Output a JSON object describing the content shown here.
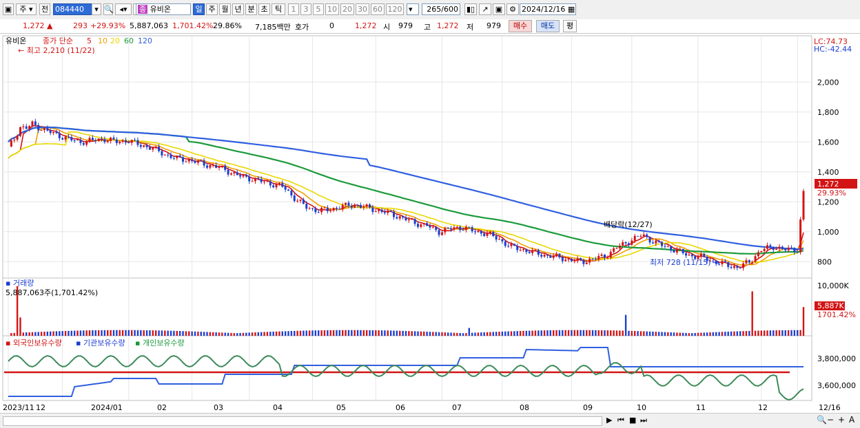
{
  "toolbar": {
    "market_type": "주",
    "prev_label": "전",
    "code": "084440",
    "stock_name": "유비온",
    "name_badge": "종",
    "periods": [
      "일",
      "주",
      "월",
      "년",
      "분",
      "초",
      "틱"
    ],
    "active_period": "일",
    "intervals": [
      "1",
      "3",
      "5",
      "10",
      "20",
      "30",
      "60",
      "120"
    ],
    "count": "265",
    "count_max": "/600",
    "date": "2024/12/16"
  },
  "quote": {
    "price": "1,272",
    "change": "293",
    "change_pct": "+29.93%",
    "volume": "5,887,063",
    "volume_ratio": "1,701.42%",
    "turnover": "29.86%",
    "amount": "7,185백만",
    "hoga_label": "호가",
    "hoga_value": "0",
    "hoga_price": "1,272",
    "open_label": "시",
    "open": "979",
    "high_label": "고",
    "high": "1,272",
    "low_label": "저",
    "low": "979",
    "buy_label": "매수",
    "sell_label": "매도",
    "eval_label": "평"
  },
  "chart_data": {
    "type": "candlestick",
    "title": "유비온",
    "ma_legend": {
      "label": "종가 단순",
      "periods": [
        "5",
        "10",
        "20",
        "60",
        "120"
      ],
      "colors": [
        "#d21414",
        "#f0a000",
        "#e8d800",
        "#1a9a3a",
        "#2f5fe0"
      ]
    },
    "price_axis": {
      "ticks": [
        800,
        1000,
        1200,
        1400,
        1600,
        1800,
        2000
      ],
      "ylim": [
        700,
        2300
      ]
    },
    "lc_label": "LC:74.73",
    "hc_label": "HC:-42.44",
    "current_price_label": "1,272",
    "current_pct_label": "29.93%",
    "annotations": {
      "high": "최고 2,210 (11/22)",
      "low": "최저 728 (11/15)",
      "dividend": "배당락(12/27)"
    },
    "price_path": [
      [
        0,
        1560
      ],
      [
        1,
        1620
      ],
      [
        2,
        1700
      ],
      [
        3,
        1690
      ],
      [
        4,
        1720
      ],
      [
        5,
        1700
      ],
      [
        6,
        1680
      ],
      [
        8,
        1650
      ],
      [
        10,
        1620
      ],
      [
        12,
        1600
      ],
      [
        14,
        1610
      ],
      [
        16,
        1620
      ],
      [
        18,
        1600
      ],
      [
        20,
        1610
      ],
      [
        22,
        1580
      ],
      [
        24,
        1560
      ],
      [
        26,
        1520
      ],
      [
        28,
        1490
      ],
      [
        30,
        1480
      ],
      [
        32,
        1460
      ],
      [
        34,
        1440
      ],
      [
        36,
        1420
      ],
      [
        38,
        1380
      ],
      [
        40,
        1360
      ],
      [
        42,
        1340
      ],
      [
        44,
        1320
      ],
      [
        46,
        1300
      ],
      [
        48,
        1220
      ],
      [
        50,
        1160
      ],
      [
        52,
        1140
      ],
      [
        54,
        1150
      ],
      [
        56,
        1170
      ],
      [
        58,
        1180
      ],
      [
        60,
        1160
      ],
      [
        62,
        1140
      ],
      [
        64,
        1120
      ],
      [
        66,
        1090
      ],
      [
        68,
        1060
      ],
      [
        70,
        1040
      ],
      [
        72,
        1000
      ],
      [
        74,
        1020
      ],
      [
        76,
        1030
      ],
      [
        78,
        1000
      ],
      [
        80,
        990
      ],
      [
        82,
        950
      ],
      [
        84,
        900
      ],
      [
        86,
        880
      ],
      [
        88,
        860
      ],
      [
        90,
        840
      ],
      [
        92,
        830
      ],
      [
        94,
        810
      ],
      [
        96,
        800
      ],
      [
        98,
        820
      ],
      [
        100,
        840
      ],
      [
        102,
        900
      ],
      [
        104,
        940
      ],
      [
        106,
        980
      ],
      [
        108,
        930
      ],
      [
        110,
        900
      ],
      [
        112,
        870
      ],
      [
        114,
        840
      ],
      [
        116,
        830
      ],
      [
        118,
        800
      ],
      [
        120,
        780
      ],
      [
        122,
        760
      ],
      [
        124,
        800
      ],
      [
        126,
        880
      ],
      [
        128,
        900
      ],
      [
        130,
        880
      ],
      [
        132,
        880
      ],
      [
        133,
        1272
      ]
    ],
    "volume_axis": {
      "ticks": [
        "10,000K"
      ],
      "label": "거래량"
    },
    "volume_current_label": "5,887,063주(1,701.42%)",
    "volume_tag": "5,887K",
    "volume_tag_pct": "1701.42%",
    "holdings_legend": [
      "외국인보유수량",
      "기관보유수량",
      "개인보유수량"
    ],
    "holdings_axis": {
      "ticks": [
        "3,800,000",
        "3,600,000"
      ]
    },
    "x_labels": [
      "2023/11",
      "12",
      "2024/01",
      "02",
      "03",
      "04",
      "05",
      "06",
      "07",
      "08",
      "09",
      "10",
      "11",
      "12",
      "12/16"
    ]
  },
  "colors": {
    "up": "#d21414",
    "down": "#1c3fd0",
    "ma5": "#d21414",
    "ma10": "#f0a000",
    "ma20": "#e8d800",
    "ma60": "#1a9a3a",
    "ma120": "#2f5fe0"
  }
}
